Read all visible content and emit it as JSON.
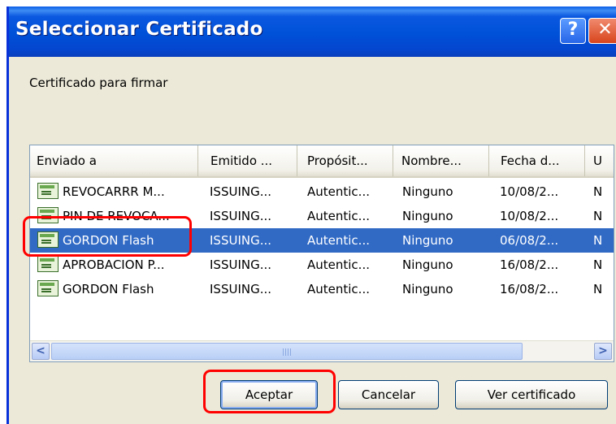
{
  "window": {
    "title": "Seleccionar Certificado",
    "help_glyph": "?",
    "close_glyph": "✕"
  },
  "prompt": "Certificado para firmar",
  "columns": [
    "Enviado a",
    "Emitido ...",
    "Propósit...",
    "Nombre...",
    "Fecha d...",
    "U"
  ],
  "rows": [
    [
      "REVOCARRR M...",
      "ISSUING...",
      "Autentic...",
      "Ninguno",
      "10/08/2...",
      "N"
    ],
    [
      "PIN DE REVOCA...",
      "ISSUING...",
      "Autentic...",
      "Ninguno",
      "10/08/2...",
      "N"
    ],
    [
      "GORDON Flash",
      "ISSUING...",
      "Autentic...",
      "Ninguno",
      "06/08/2...",
      "N"
    ],
    [
      "APROBACION P...",
      "ISSUING...",
      "Autentic...",
      "Ninguno",
      "16/08/2...",
      "N"
    ],
    [
      "GORDON Flash",
      "ISSUING...",
      "Autentic...",
      "Ninguno",
      "16/08/2...",
      "N"
    ]
  ],
  "selected_row": 2,
  "scrollbar": {
    "left_glyph": "<",
    "right_glyph": ">"
  },
  "buttons": {
    "accept": "Aceptar",
    "cancel": "Cancelar",
    "view": "Ver certificado"
  },
  "colors": {
    "selection": "#316ac5",
    "highlight": "#ff0000",
    "titlebar": "#0050d8"
  },
  "icons": {
    "row_icon": "certificate-icon",
    "help": "help-icon",
    "close": "close-icon"
  }
}
